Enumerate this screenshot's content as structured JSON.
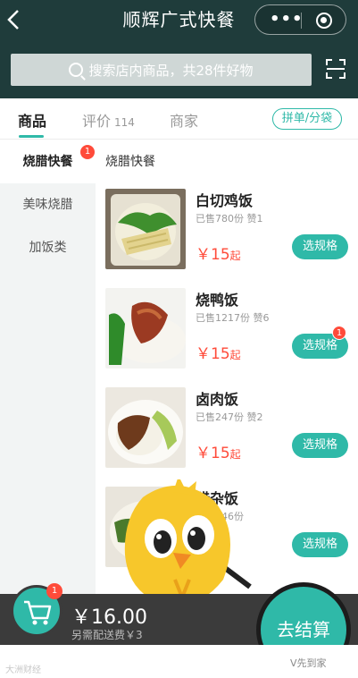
{
  "header": {
    "title": "顺辉广式快餐",
    "back_icon": "chevron-left-icon",
    "more_icon": "more-dots-icon",
    "close_icon": "target-close-icon"
  },
  "search": {
    "placeholder": "搜索店内商品，共28件好物",
    "scan_icon": "scan-icon"
  },
  "tabs": [
    {
      "label": "商品",
      "count": ""
    },
    {
      "label": "评价",
      "count": "114"
    },
    {
      "label": "商家",
      "count": ""
    }
  ],
  "group_button": "拼单/分袋",
  "categories": [
    {
      "label": "烧腊快餐",
      "badge": "1"
    },
    {
      "label": "美味烧腊",
      "badge": ""
    },
    {
      "label": "加饭类",
      "badge": ""
    }
  ],
  "section_title": "烧腊快餐",
  "products": [
    {
      "name": "白切鸡饭",
      "sales": "已售780份",
      "likes": "赞1",
      "price": "￥15",
      "from": "起",
      "button": "选规格",
      "badge": ""
    },
    {
      "name": "烧鸭饭",
      "sales": "已售1217份",
      "likes": "赞6",
      "price": "￥15",
      "from": "起",
      "button": "选规格",
      "badge": "1"
    },
    {
      "name": "卤肉饭",
      "sales": "已售247份",
      "likes": "赞2",
      "price": "￥15",
      "from": "起",
      "button": "选规格",
      "badge": ""
    },
    {
      "name": "腊杂饭",
      "sales": "已售346份",
      "likes": "",
      "price": "",
      "from": "",
      "button": "选规格",
      "badge": ""
    }
  ],
  "cart": {
    "badge": "1",
    "total": "￥16.00",
    "delivery_fee": "另需配送费￥3",
    "checkout": "去结算",
    "icon": "shopping-cart-icon"
  },
  "watermarks": {
    "left": "大洲财经",
    "right": "V先到家"
  },
  "colors": {
    "header_bg": "#1f3c3b",
    "accent": "#2fb9a8",
    "price": "#ff4b3a",
    "cart_bar": "#3b3b3b"
  }
}
